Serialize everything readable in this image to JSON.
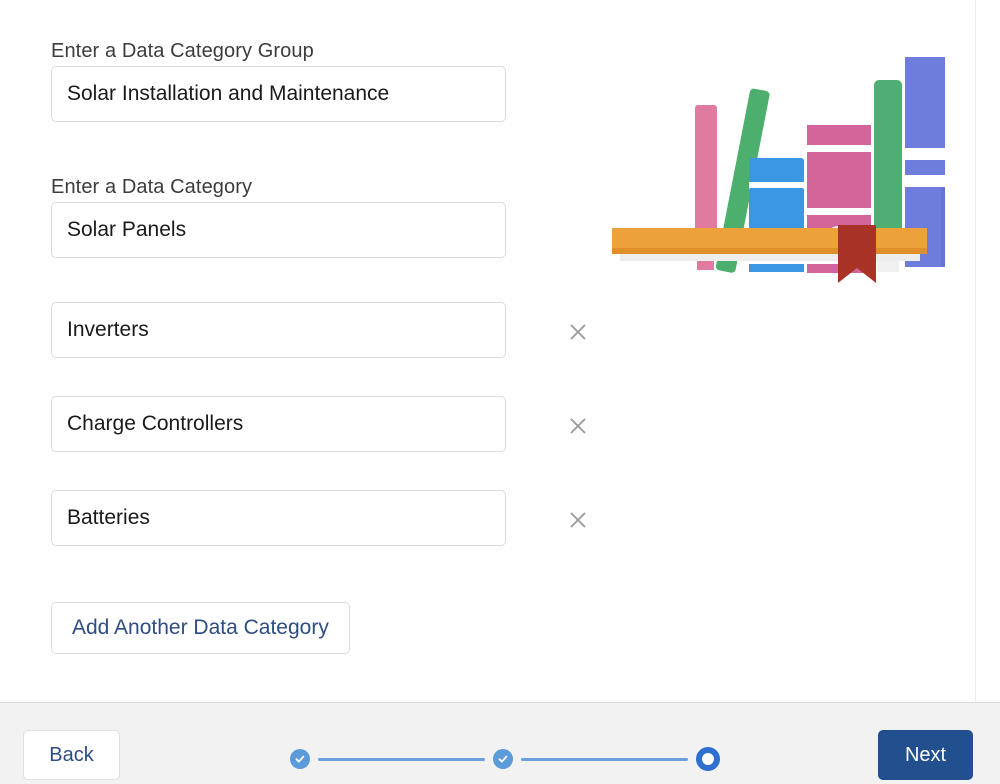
{
  "form": {
    "group_label": "Enter a Data Category Group",
    "group_value": "Solar Installation and Maintenance",
    "group_placeholder": "Enter a Data Category Group",
    "category_label": "Enter a Data Category",
    "category_placeholder": "Enter a Data Category",
    "categories": [
      {
        "value": "Solar Panels",
        "removable": false
      },
      {
        "value": "Inverters",
        "removable": true
      },
      {
        "value": "Charge Controllers",
        "removable": true
      },
      {
        "value": "Batteries",
        "removable": true
      }
    ],
    "remove_icon": "close-icon",
    "add_button_label": "Add Another Data Category"
  },
  "illustration": {
    "name": "bookshelf-illustration",
    "shelf_color": "#eda13a",
    "shelf_shadow_color": "#de8f2a",
    "bookmark_color": "#a93226",
    "books": [
      {
        "name": "pink-thin-book",
        "color": "#e07a9f"
      },
      {
        "name": "green-leaning-book",
        "color": "#4caf6d"
      },
      {
        "name": "blue-book",
        "color": "#3b97e3"
      },
      {
        "name": "magenta-book",
        "color": "#d4659a"
      },
      {
        "name": "green-tall-book",
        "color": "#4fae72"
      },
      {
        "name": "purple-tall-book",
        "color": "#6e7ddb"
      }
    ]
  },
  "footer": {
    "back_label": "Back",
    "next_label": "Next",
    "accent_color": "#22508f",
    "steps": [
      {
        "name": "step-1",
        "state": "done"
      },
      {
        "name": "step-2",
        "state": "done"
      },
      {
        "name": "step-3",
        "state": "current"
      }
    ]
  },
  "scrollbar": {
    "name": "vertical-scrollbar",
    "thumb_color": "#c3c3c3"
  }
}
